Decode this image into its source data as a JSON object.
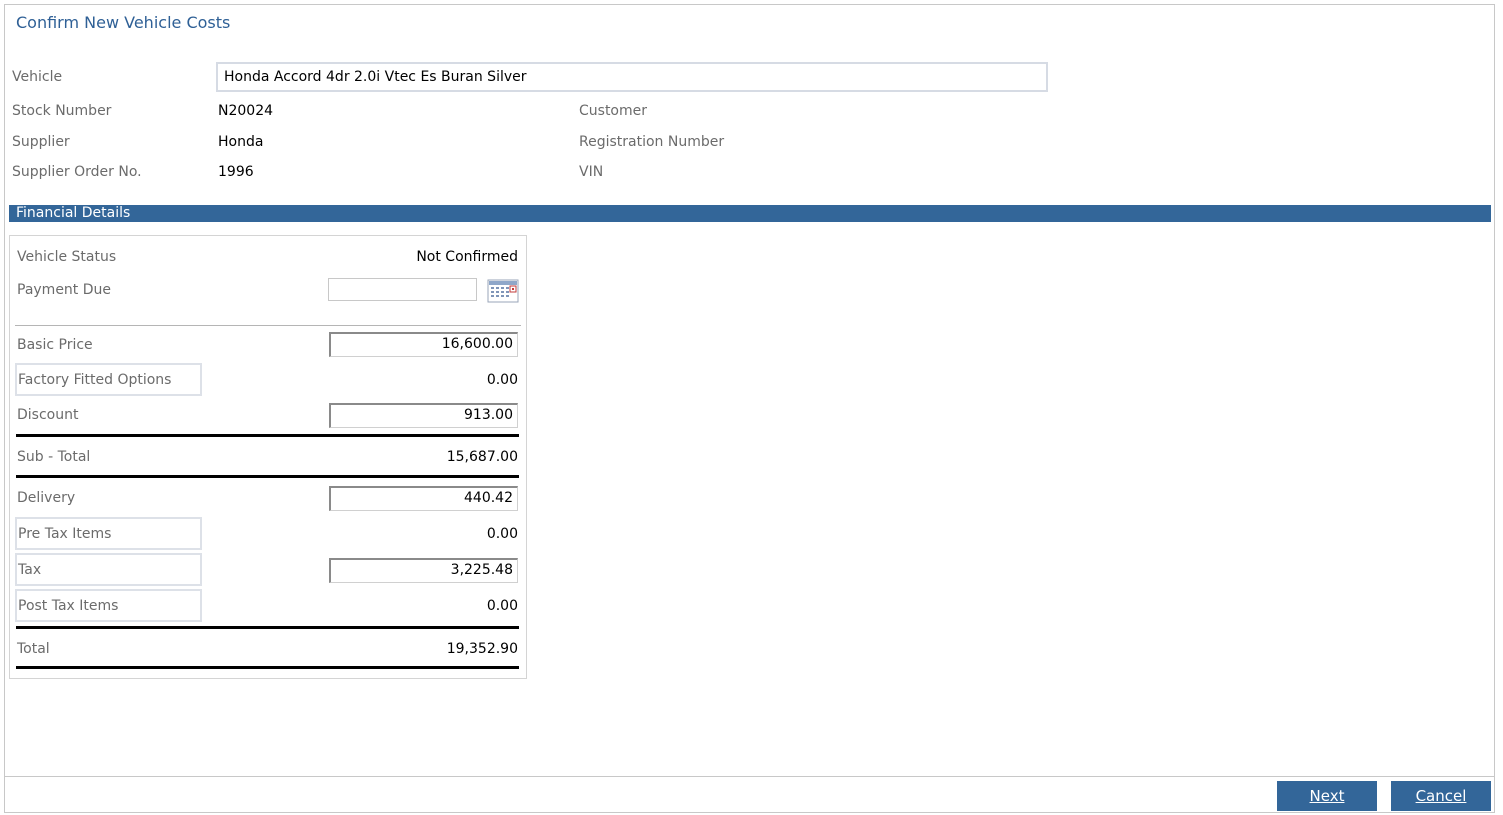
{
  "page": {
    "title": "Confirm New Vehicle Costs"
  },
  "vehicle": {
    "label": "Vehicle",
    "value": "Honda Accord 4dr 2.0i Vtec Es Buran Silver"
  },
  "info": {
    "stock_number_label": "Stock Number",
    "stock_number": "N20024",
    "supplier_label": "Supplier",
    "supplier": "Honda",
    "supplier_order_label": "Supplier Order No.",
    "supplier_order": "1996",
    "customer_label": "Customer",
    "registration_label": "Registration Number",
    "vin_label": "VIN"
  },
  "financial": {
    "section_title": "Financial Details",
    "vehicle_status_label": "Vehicle Status",
    "vehicle_status": "Not Confirmed",
    "payment_due_label": "Payment Due",
    "payment_due": "",
    "calendar_icon": "calendar-icon",
    "basic_price_label": "Basic Price",
    "basic_price": "16,600.00",
    "factory_options_label": "Factory Fitted Options",
    "factory_options": "0.00",
    "discount_label": "Discount",
    "discount": "913.00",
    "subtotal_label": "Sub - Total",
    "subtotal": "15,687.00",
    "delivery_label": "Delivery",
    "delivery": "440.42",
    "pre_tax_label": "Pre Tax Items",
    "pre_tax": "0.00",
    "tax_label": "Tax",
    "tax": "3,225.48",
    "post_tax_label": "Post Tax Items",
    "post_tax": "0.00",
    "total_label": "Total",
    "total": "19,352.90"
  },
  "buttons": {
    "next": "Next",
    "cancel": "Cancel"
  },
  "colors": {
    "accent": "#336699",
    "title": "#2f6096"
  }
}
